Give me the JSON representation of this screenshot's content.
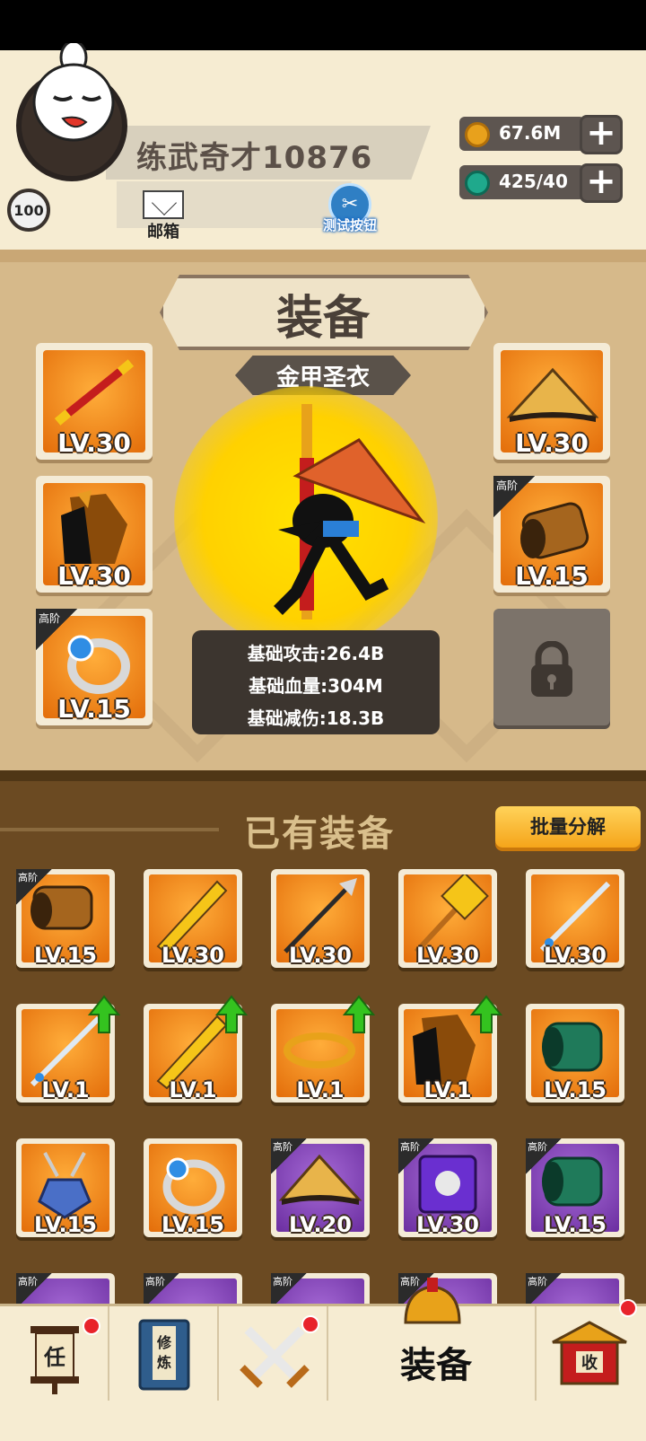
{
  "player": {
    "name": "练武奇才10876",
    "level": "100",
    "mail_label": "邮箱",
    "test_button_label": "测试按钮"
  },
  "resources": [
    {
      "icon": "coin-icon",
      "value": "67.6M",
      "color": "#e8a11c"
    },
    {
      "icon": "gem-icon",
      "value": "425/40",
      "color": "#1fa98c"
    }
  ],
  "equipment": {
    "title": "装备",
    "set_name": "金甲圣衣",
    "left_slots": [
      {
        "icon": "staff-icon",
        "level": "LV.30",
        "tag": ""
      },
      {
        "icon": "cloak-icon",
        "level": "LV.30",
        "tag": ""
      },
      {
        "icon": "ring-icon",
        "level": "LV.15",
        "tag": "高阶"
      }
    ],
    "right_slots": [
      {
        "icon": "straw-hat-icon",
        "level": "LV.30",
        "tag": ""
      },
      {
        "icon": "bracer-icon",
        "level": "LV.15",
        "tag": "高阶"
      }
    ],
    "stats": [
      "基础攻击:26.4B",
      "基础血量:304M",
      "基础减伤:18.3B"
    ]
  },
  "inventory": {
    "title": "已有装备",
    "batch_button": "批量分解",
    "items": [
      {
        "icon": "bracer-icon",
        "level": "LV.15",
        "tag": "高阶",
        "rarity": "orange",
        "upgrade": false
      },
      {
        "icon": "broadsword-icon",
        "level": "LV.30",
        "tag": "",
        "rarity": "orange",
        "upgrade": false
      },
      {
        "icon": "spear-icon",
        "level": "LV.30",
        "tag": "",
        "rarity": "orange",
        "upgrade": false
      },
      {
        "icon": "hammer-icon",
        "level": "LV.30",
        "tag": "",
        "rarity": "orange",
        "upgrade": false
      },
      {
        "icon": "sword-icon",
        "level": "LV.30",
        "tag": "",
        "rarity": "orange",
        "upgrade": false
      },
      {
        "icon": "sword-icon",
        "level": "LV.1",
        "tag": "",
        "rarity": "orange",
        "upgrade": true
      },
      {
        "icon": "broadsword-icon",
        "level": "LV.1",
        "tag": "",
        "rarity": "orange",
        "upgrade": true
      },
      {
        "icon": "headband-icon",
        "level": "LV.1",
        "tag": "",
        "rarity": "orange",
        "upgrade": true
      },
      {
        "icon": "cloak-icon",
        "level": "LV.1",
        "tag": "",
        "rarity": "orange",
        "upgrade": true
      },
      {
        "icon": "armguard-icon",
        "level": "LV.15",
        "tag": "",
        "rarity": "orange",
        "upgrade": false
      },
      {
        "icon": "amulet-icon",
        "level": "LV.15",
        "tag": "",
        "rarity": "orange",
        "upgrade": false
      },
      {
        "icon": "ring-icon",
        "level": "LV.15",
        "tag": "",
        "rarity": "orange",
        "upgrade": false
      },
      {
        "icon": "straw-hat-icon",
        "level": "LV.20",
        "tag": "高阶",
        "rarity": "purple",
        "upgrade": false
      },
      {
        "icon": "armor-icon",
        "level": "LV.30",
        "tag": "高阶",
        "rarity": "purple",
        "upgrade": false
      },
      {
        "icon": "armguard-icon",
        "level": "LV.15",
        "tag": "高阶",
        "rarity": "purple",
        "upgrade": false
      }
    ],
    "partial_row_tags": [
      "高阶",
      "高阶",
      "高阶",
      "高阶",
      "高阶"
    ]
  },
  "nav": {
    "tasks_glyph": "任",
    "cultivate_glyph": "修炼",
    "equip_label": "装备",
    "collect_glyph": "收"
  }
}
